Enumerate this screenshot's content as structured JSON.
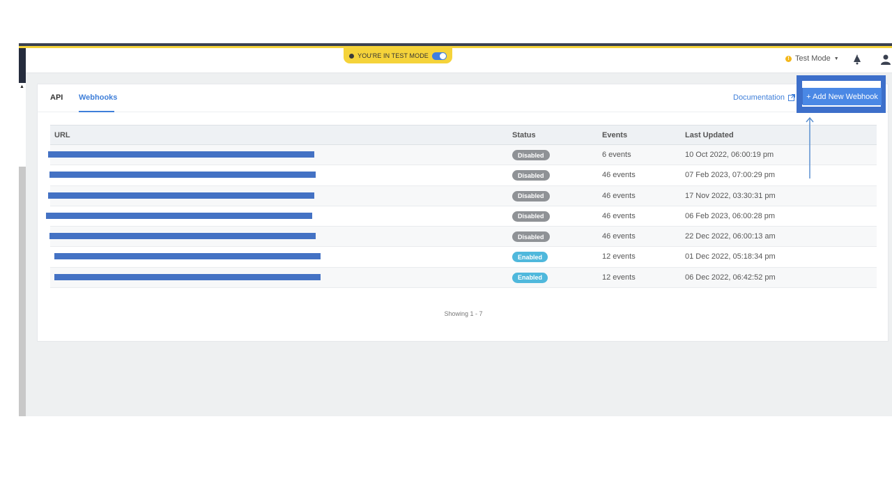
{
  "banner": {
    "label": "YOU'RE IN TEST MODE"
  },
  "header": {
    "mode_label": "Test Mode"
  },
  "tabs": [
    {
      "label": "API"
    },
    {
      "label": "Webhooks"
    }
  ],
  "documentation_label": "Documentation",
  "add_button_label": "+ Add New Webhook",
  "table": {
    "columns": [
      "URL",
      "Status",
      "Events",
      "Last Updated"
    ],
    "rows": [
      {
        "status": "Disabled",
        "events": "6 events",
        "updated": "10 Oct 2022, 06:00:19 pm"
      },
      {
        "status": "Disabled",
        "events": "46 events",
        "updated": "07 Feb 2023, 07:00:29 pm"
      },
      {
        "status": "Disabled",
        "events": "46 events",
        "updated": "17 Nov 2022, 03:30:31 pm"
      },
      {
        "status": "Disabled",
        "events": "46 events",
        "updated": "06 Feb 2023, 06:00:28 pm"
      },
      {
        "status": "Disabled",
        "events": "46 events",
        "updated": "22 Dec 2022, 06:00:13 am"
      },
      {
        "status": "Enabled",
        "events": "12 events",
        "updated": "01 Dec 2022, 05:18:34 pm"
      },
      {
        "status": "Enabled",
        "events": "12 events",
        "updated": "06 Dec 2022, 06:42:52 pm"
      }
    ]
  },
  "footer": {
    "showing": "Showing 1 - 7"
  },
  "colors": {
    "disabled_badge": "#8f9296",
    "enabled_badge": "#4fb8dc",
    "accent": "#3f7fd9",
    "banner": "#f5d33a"
  },
  "icons": [
    "info-dot-icon",
    "toggle-switch",
    "warning-dot-icon",
    "caret-down-icon",
    "notification-icon",
    "user-icon",
    "external-link-icon",
    "arrow-up-icon"
  ]
}
